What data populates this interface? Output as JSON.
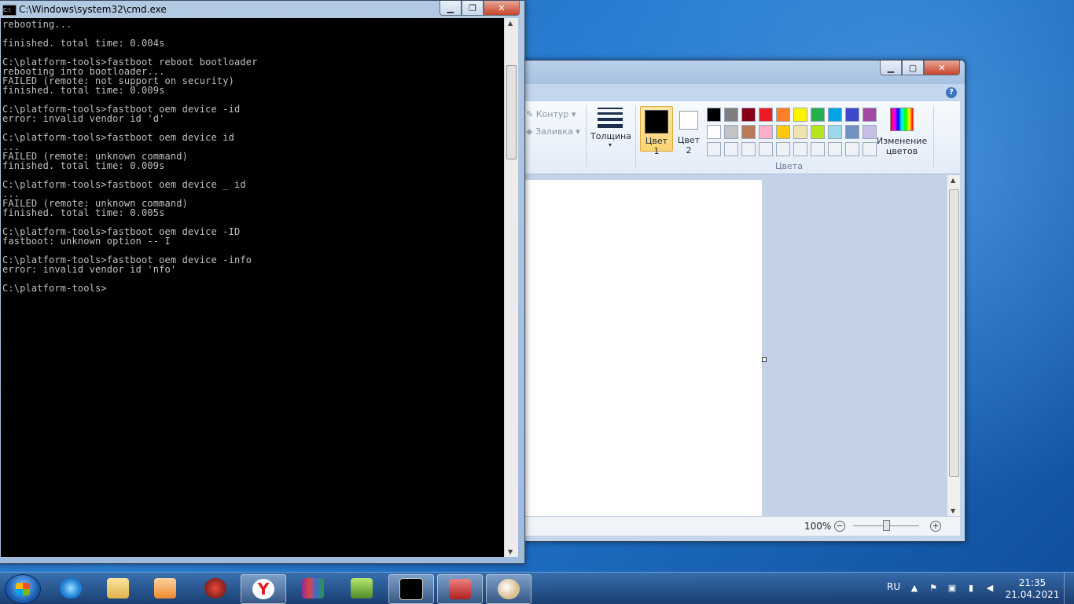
{
  "cmd": {
    "title": "C:\\Windows\\system32\\cmd.exe",
    "icon": "C:\\",
    "console_text": "rebooting...\n\nfinished. total time: 0.004s\n\nC:\\platform-tools>fastboot reboot bootloader\nrebooting into bootloader...\nFAILED (remote: not support on security)\nfinished. total time: 0.009s\n\nC:\\platform-tools>fastboot oem device -id\nerror: invalid vendor id 'd'\n\nC:\\platform-tools>fastboot oem device id\n...\nFAILED (remote: unknown command)\nfinished. total time: 0.009s\n\nC:\\platform-tools>fastboot oem device _ id\n...\nFAILED (remote: unknown command)\nfinished. total time: 0.005s\n\nC:\\platform-tools>fastboot oem device -ID\nfastboot: unknown option -- I\n\nC:\\platform-tools>fastboot oem device -info\nerror: invalid vendor id 'nfo'\n\nC:\\platform-tools>"
  },
  "paint": {
    "outline_label": "Контур",
    "fill_label": "Заливка",
    "thickness_label": "Толщина",
    "color1_line1": "Цвет",
    "color1_line2": "1",
    "color2_line1": "Цвет",
    "color2_line2": "2",
    "colors_group_label": "Цвета",
    "edit_colors_line1": "Изменение",
    "edit_colors_line2": "цветов",
    "help": "?",
    "zoom": "100%",
    "palette": [
      "#000000",
      "#7f7f7f",
      "#880015",
      "#ed1c24",
      "#ff7f27",
      "#fff200",
      "#22b14c",
      "#00a2e8",
      "#3f48cc",
      "#a349a4",
      "#ffffff",
      "#c3c3c3",
      "#b97a57",
      "#ffaec9",
      "#ffc90e",
      "#efe4b0",
      "#b5e61d",
      "#99d9ea",
      "#7092be",
      "#c8bfe7",
      "#eef2f7",
      "#eef2f7",
      "#eef2f7",
      "#eef2f7",
      "#eef2f7",
      "#eef2f7",
      "#eef2f7",
      "#eef2f7",
      "#eef2f7",
      "#eef2f7"
    ]
  },
  "taskbar": {
    "apps": [
      "internet-explorer-icon",
      "explorer-icon",
      "media-player-icon",
      "security-icon",
      "yandex-browser-icon",
      "winrar-icon",
      "android-tool-icon",
      "cmd-icon",
      "toolbox-icon",
      "paint-icon"
    ],
    "lang": "RU",
    "time": "21:35",
    "date": "21.04.2021"
  }
}
